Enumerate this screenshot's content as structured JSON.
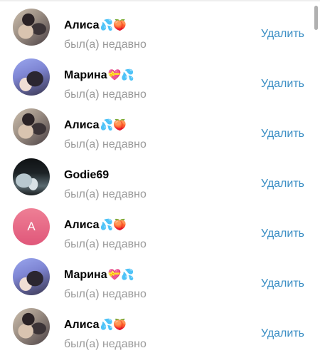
{
  "contacts": [
    {
      "name": "Алиса",
      "emoji": "💦🍑",
      "status": "был(а) недавно",
      "remove_label": "Удалить",
      "avatar": "photo-alisa"
    },
    {
      "name": "Марина",
      "emoji": "💝💦",
      "status": "был(а) недавно",
      "remove_label": "Удалить",
      "avatar": "photo-marina"
    },
    {
      "name": "Алиса",
      "emoji": "💦🍑",
      "status": "был(а) недавно",
      "remove_label": "Удалить",
      "avatar": "photo-alisa"
    },
    {
      "name": "Godie69",
      "emoji": "",
      "status": "был(а) недавно",
      "remove_label": "Удалить",
      "avatar": "photo-godie"
    },
    {
      "name": "Алиса",
      "emoji": "💦🍑",
      "status": "был(а) недавно",
      "remove_label": "Удалить",
      "avatar": "letter",
      "avatar_letter": "A",
      "avatar_color": "#e86a86"
    },
    {
      "name": "Марина",
      "emoji": "💝💦",
      "status": "был(а) недавно",
      "remove_label": "Удалить",
      "avatar": "photo-marina"
    },
    {
      "name": "Алиса",
      "emoji": "💦🍑",
      "status": "был(а) недавно",
      "remove_label": "Удалить",
      "avatar": "photo-alisa"
    }
  ],
  "colors": {
    "remove_link": "#3a8ec4",
    "status_text": "#999999"
  }
}
